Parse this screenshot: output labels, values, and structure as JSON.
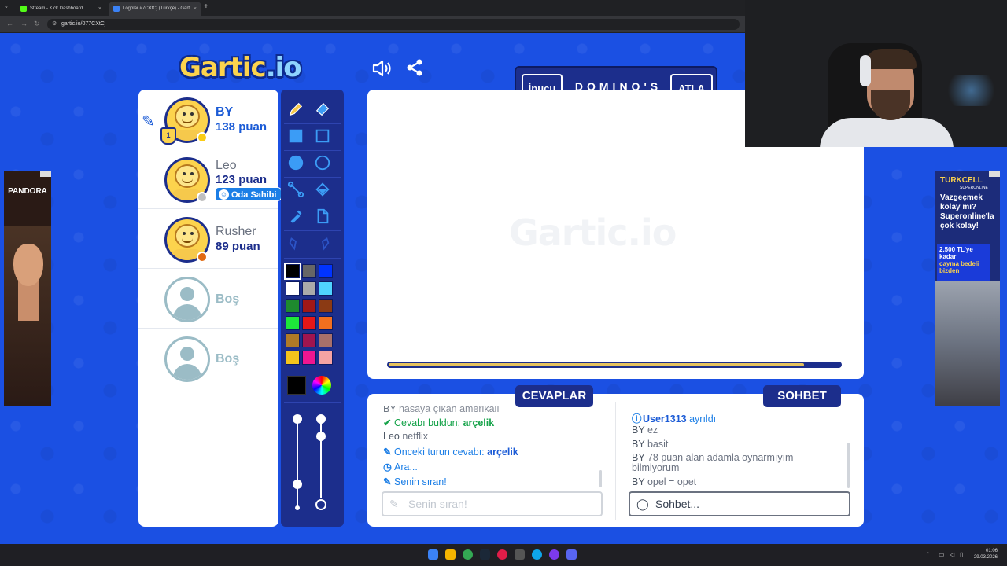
{
  "browser": {
    "tabs": [
      {
        "title": "Stream - Kick Dashboard",
        "close": "×"
      },
      {
        "title": "Logolar #7CXtCj (Türkçe) - Gartic.io",
        "close": "×"
      }
    ],
    "new_tab": "+",
    "url": "gartic.io/077CXtCj"
  },
  "game": {
    "logo_a": "Gartic",
    "logo_b": ".io",
    "hint_label": "İpucu",
    "word": "DOMINO'S",
    "skip_label": "ATLA",
    "timer_fraction": 0.92
  },
  "players": [
    {
      "name": "BY",
      "score": "138 puan",
      "status_color": "#facc15",
      "is_me": true,
      "rank": "1"
    },
    {
      "name": "Leo",
      "score": "123 puan",
      "status_color": "#bfbfbf",
      "badge": "Oda Sahibi"
    },
    {
      "name": "Rusher",
      "score": "89 puan",
      "status_color": "#e16a12"
    },
    {
      "name": "Boş",
      "empty": true
    },
    {
      "name": "Boş",
      "empty": true
    }
  ],
  "palette": {
    "colors": [
      "#000000",
      "#666666",
      "#0033ff",
      "#ffffff",
      "#aaaaaa",
      "#4fd3ff",
      "#1e8a2e",
      "#a01818",
      "#8b3a14",
      "#1de73a",
      "#e51717",
      "#f26f1f",
      "#b07a27",
      "#a0154f",
      "#a8706a",
      "#f5c41c",
      "#ee1690",
      "#f5a3a3"
    ],
    "current_color": "#000000"
  },
  "answers": {
    "tab_label": "CEVAPLAR",
    "messages": {
      "m0_user": "BY",
      "m0_text": "hasaya çıkan amerikalı",
      "m1_label": "Cevabı buldun: ",
      "m1_answer": "arçelik",
      "m2_user": "Leo",
      "m2_text": "netflix",
      "m3_label": "Önceki turun cevabı: ",
      "m3_answer": "arçelik",
      "m4_text": "Ara...",
      "m5_text": "Senin sıran!"
    },
    "input_placeholder": "Senin sıran!"
  },
  "chat": {
    "tab_label": "SOHBET",
    "messages": {
      "c0_user": "User1313",
      "c0_text": "ayrıldı",
      "c1_user": "BY",
      "c1_text": "ez",
      "c2_user": "BY",
      "c2_text": "basit",
      "c3_user": "BY",
      "c3_text": "78 puan alan adamla oynarmıyım",
      "c3_text2": "bilmiyorum",
      "c4_user": "BY",
      "c4_text": "opel = opet"
    },
    "input_placeholder": "Sohbet..."
  },
  "ads": {
    "left_brand": "PANDORA",
    "right_brand": "TURKCELL",
    "right_sub": "SUPERONLINE",
    "right_text": "Vazgeçmek kolay mı? Superonline'la çok kolay!",
    "right_box_a": "2.500 TL'ye kadar",
    "right_box_b": "cayma bedeli bizden"
  },
  "taskbar": {
    "time": "01:06",
    "date": "29.03.2026"
  }
}
